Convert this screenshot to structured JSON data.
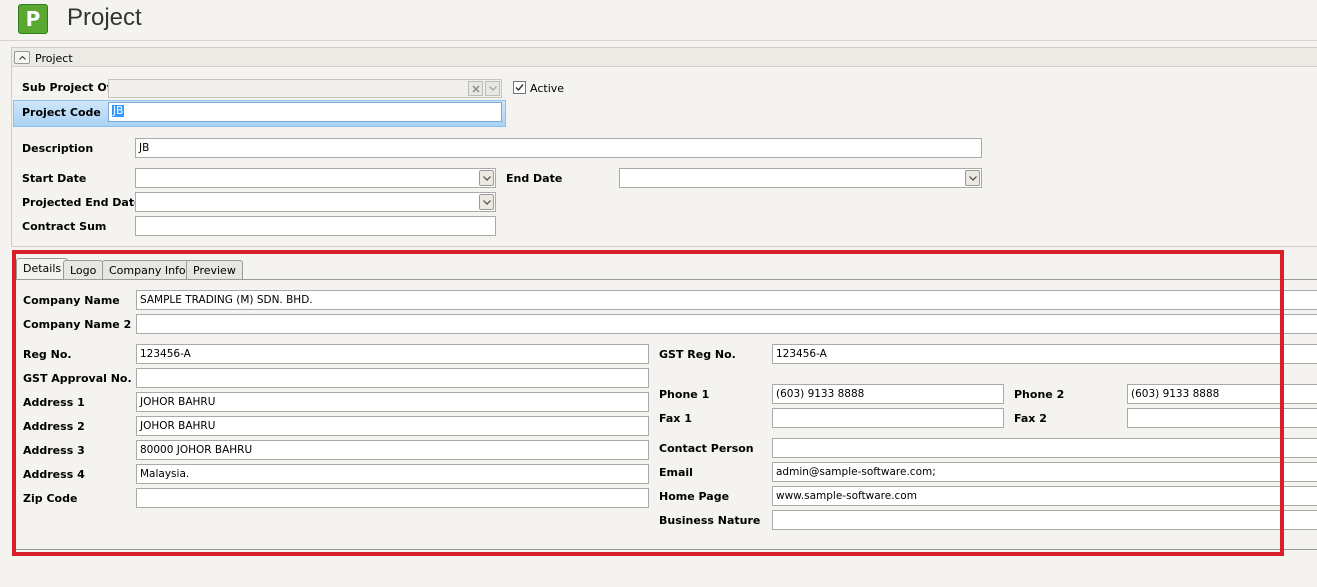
{
  "header": {
    "logo_letter": "P",
    "title": "Project"
  },
  "section": {
    "title": "Project"
  },
  "form": {
    "sub_project_of_label": "Sub Project Of",
    "sub_project_of_value": "",
    "active_label": "Active",
    "active_checked": true,
    "project_code_label": "Project Code",
    "project_code_value": "JB",
    "description_label": "Description",
    "description_value": "JB",
    "start_date_label": "Start Date",
    "start_date_value": "",
    "end_date_label": "End Date",
    "end_date_value": "",
    "projected_end_date_label": "Projected End Date",
    "projected_end_date_value": "",
    "contract_sum_label": "Contract Sum",
    "contract_sum_value": ""
  },
  "tabs": [
    "Details",
    "Logo",
    "Company Info",
    "Preview"
  ],
  "details": {
    "company_name_label": "Company Name",
    "company_name_value": "SAMPLE TRADING (M) SDN. BHD.",
    "company_name2_label": "Company Name 2",
    "company_name2_value": "",
    "reg_no_label": "Reg No.",
    "reg_no_value": "123456-A",
    "gst_approval_label": "GST Approval No.",
    "gst_approval_value": "",
    "address1_label": "Address 1",
    "address1_value": "JOHOR BAHRU",
    "address2_label": "Address 2",
    "address2_value": "JOHOR BAHRU",
    "address3_label": "Address 3",
    "address3_value": "80000 JOHOR BAHRU",
    "address4_label": "Address 4",
    "address4_value": "Malaysia.",
    "zip_label": "Zip Code",
    "zip_value": "",
    "gst_reg_label": "GST Reg No.",
    "gst_reg_value": "123456-A",
    "phone1_label": "Phone 1",
    "phone1_value": "(603) 9133 8888",
    "phone2_label": "Phone 2",
    "phone2_value": "(603) 9133 8888",
    "fax1_label": "Fax 1",
    "fax1_value": "",
    "fax2_label": "Fax 2",
    "fax2_value": "",
    "contact_label": "Contact Person",
    "contact_value": "",
    "email_label": "Email",
    "email_value": "admin@sample-software.com;",
    "homepage_label": "Home Page",
    "homepage_value": "www.sample-software.com",
    "business_label": "Business Nature",
    "business_value": ""
  },
  "colors": {
    "logo_green": "#5aa832",
    "highlight_red": "#d8202a",
    "selection_blue": "#3399ff"
  }
}
